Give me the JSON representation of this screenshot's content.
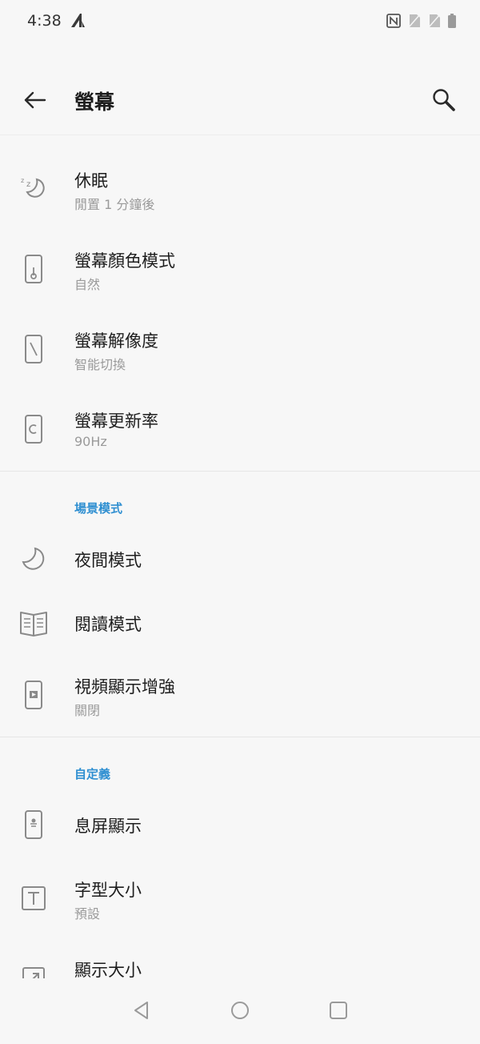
{
  "status_bar": {
    "time": "4:38",
    "icons": [
      "nfc-icon",
      "no-sim-icon",
      "no-signal-icon",
      "battery-icon"
    ]
  },
  "app_bar": {
    "title": "螢幕",
    "back_icon": "arrow-left-icon",
    "search_icon": "search-icon"
  },
  "colors": {
    "accent": "#2f8fd1",
    "icon": "#8a8a8a",
    "background": "#f7f7f7"
  },
  "settings": {
    "sleep": {
      "title": "休眠",
      "subtitle": "閒置 1 分鐘後",
      "icon": "sleep-moon-icon"
    },
    "color_mode": {
      "title": "螢幕顏色模式",
      "subtitle": "自然",
      "icon": "color-mode-icon"
    },
    "resolution": {
      "title": "螢幕解像度",
      "subtitle": "智能切換",
      "icon": "resolution-icon"
    },
    "refresh_rate": {
      "title": "螢幕更新率",
      "subtitle": "90Hz",
      "icon": "refresh-rate-icon"
    }
  },
  "scene_section": {
    "header": "場景模式",
    "night_mode": {
      "title": "夜間模式",
      "icon": "moon-icon"
    },
    "reading_mode": {
      "title": "閱讀模式",
      "icon": "book-icon"
    },
    "video_enhance": {
      "title": "視頻顯示增強",
      "subtitle": "關閉",
      "icon": "video-enhance-icon"
    }
  },
  "custom_section": {
    "header": "自定義",
    "ambient_display": {
      "title": "息屏顯示",
      "icon": "ambient-display-icon"
    },
    "font_size": {
      "title": "字型大小",
      "subtitle": "預設",
      "icon": "font-size-icon"
    },
    "display_size": {
      "title": "顯示大小",
      "icon": "display-size-icon"
    }
  },
  "nav_bar": {
    "back": "nav-back-icon",
    "home": "nav-home-icon",
    "recents": "nav-recents-icon"
  }
}
